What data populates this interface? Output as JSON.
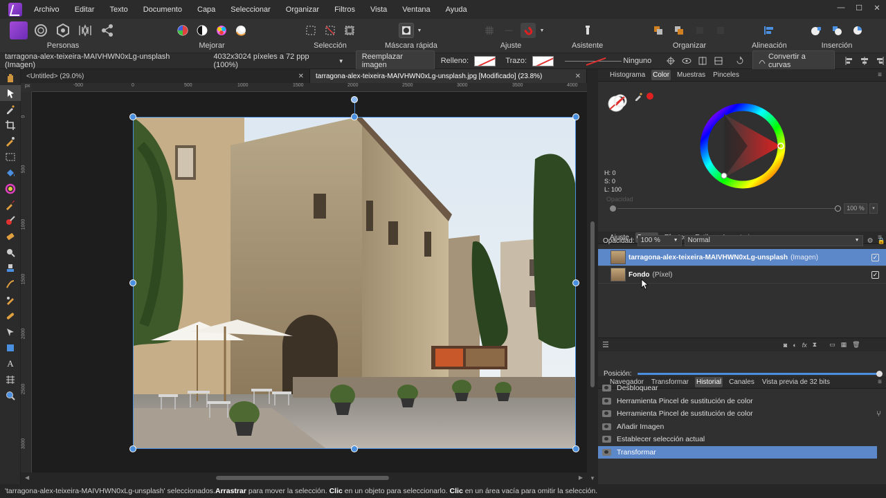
{
  "menubar": {
    "items": [
      "Archivo",
      "Editar",
      "Texto",
      "Documento",
      "Capa",
      "Seleccionar",
      "Organizar",
      "Filtros",
      "Vista",
      "Ventana",
      "Ayuda"
    ],
    "window_controls": [
      "—",
      "☐",
      "✕"
    ]
  },
  "toolbar": {
    "personas_label": "Personas",
    "mejorar_label": "Mejorar",
    "seleccion_label": "Selección",
    "mascara_label": "Máscara rápida",
    "ajuste_label": "Ajuste",
    "asistente_label": "Asistente",
    "organizar_label": "Organizar",
    "alineacion_label": "Alineación",
    "insercion_label": "Inserción"
  },
  "contextbar": {
    "layer_name": "tarragona-alex-teixeira-MAIVHWN0xLg-unsplash (Imagen)",
    "dimensions": "4032x3024 píxeles a 72 ppp (100%)",
    "replace_image": "Reemplazar imagen",
    "relleno_label": "Relleno:",
    "trazo_label": "Trazo:",
    "stroke_style": "Ninguno",
    "convert_curves": "Convertir a curvas"
  },
  "doc_tabs": [
    {
      "title": "<Untitled> (29.0%)",
      "active": false
    },
    {
      "title": "tarragona-alex-teixeira-MAIVHWN0xLg-unsplash.jpg [Modificado] (23.8%)",
      "active": true
    }
  ],
  "rulers": {
    "unit": "px",
    "h_ticks": [
      "-500",
      "0",
      "500",
      "1000",
      "1500",
      "2000",
      "2500",
      "3000",
      "3500",
      "4000"
    ],
    "v_ticks": [
      "0",
      "500",
      "1000",
      "1500",
      "2000",
      "2500",
      "3000"
    ]
  },
  "color_panel": {
    "tabs": [
      "Histograma",
      "Color",
      "Muestras",
      "Pinceles"
    ],
    "active_tab": "Color",
    "h": "H: 0",
    "s": "S: 0",
    "l": "L: 100",
    "opacity_label": "Opacidad",
    "opacity_value": "100 %",
    "accent_color": "#e02020"
  },
  "layers_panel": {
    "tabs": [
      "Ajuste",
      "Capas",
      "Efectos",
      "Estilos",
      "Inventario"
    ],
    "active_tab": "Capas",
    "opacity_label": "Opacidad:",
    "opacity_value": "100 %",
    "blend_mode": "Normal",
    "layers": [
      {
        "name": "tarragona-alex-teixeira-MAIVHWN0xLg-unsplash",
        "type": "(Imagen)",
        "selected": true
      },
      {
        "name": "Fondo",
        "type": "(Píxel)",
        "selected": false
      }
    ]
  },
  "history_panel": {
    "tabs": [
      "Navegador",
      "Transformar",
      "Historial",
      "Canales",
      "Vista previa de 32 bits"
    ],
    "active_tab": "Historial",
    "position_label": "Posición:",
    "position": 1.0,
    "items": [
      "Desbloquear",
      "Herramienta Pincel de sustitución de color",
      "Herramienta Pincel de sustitución de color",
      "Añadir Imagen",
      "Establecer selección actual",
      "Transformar"
    ],
    "selected_index": 5
  },
  "statusbar": {
    "part1": "'tarragona-alex-teixeira-MAIVHWN0xLg-unsplash' seleccionados. ",
    "b1": "Arrastrar",
    "part2": " para mover la selección. ",
    "b2": "Clic",
    "part3": " en un objeto para seleccionarlo. ",
    "b3": "Clic",
    "part4": " en un área vacía para omitir la selección."
  },
  "colors": {
    "accent_blue": "#5c87c9",
    "handle_blue": "#4a8fe0",
    "affinity_purple": "#8e3fd0"
  }
}
